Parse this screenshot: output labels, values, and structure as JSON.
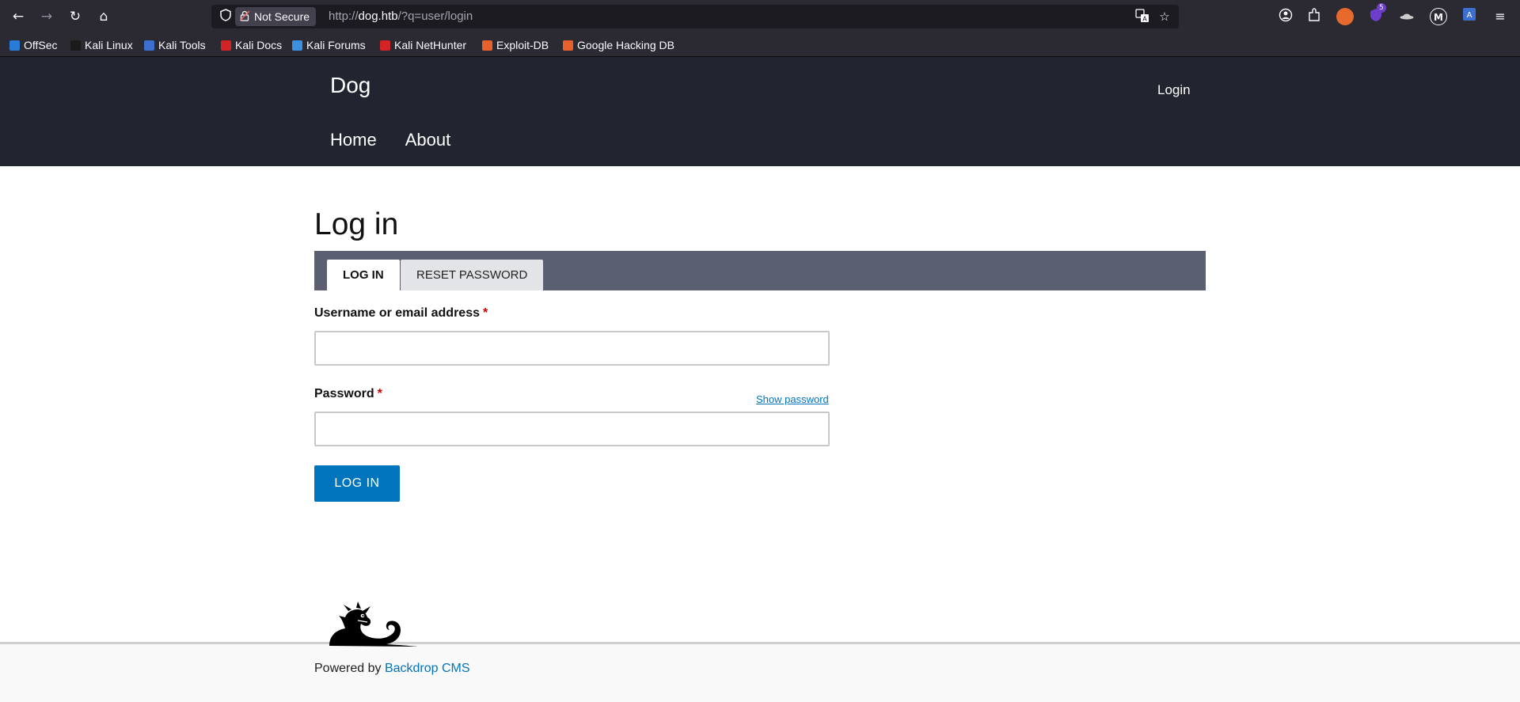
{
  "browser": {
    "nav": {
      "back_icon": "←",
      "forward_icon": "→",
      "reload_icon": "↻",
      "home_icon": "⌂"
    },
    "urlbar": {
      "security_label": "Not Secure",
      "url_prefix": "http://",
      "url_host": "dog.htb",
      "url_path": "/?q=user/login"
    },
    "extensions": {
      "badge_count": "5"
    },
    "bookmarks": [
      {
        "label": "OffSec",
        "color": "#2a7bd6"
      },
      {
        "label": "Kali Linux",
        "color": "#1b1b1b"
      },
      {
        "label": "Kali Tools",
        "color": "#3d6fd1"
      },
      {
        "label": "Kali Docs",
        "color": "#d22424"
      },
      {
        "label": "Kali Forums",
        "color": "#3d8fe0"
      },
      {
        "label": "Kali NetHunter",
        "color": "#d22424"
      },
      {
        "label": "Exploit-DB",
        "color": "#e8612c"
      },
      {
        "label": "Google Hacking DB",
        "color": "#e8612c"
      }
    ]
  },
  "site": {
    "name": "Dog",
    "header_login": "Login",
    "menu": [
      "Home",
      "About"
    ]
  },
  "page": {
    "title": "Log in",
    "tabs": [
      {
        "label": "LOG IN",
        "active": true
      },
      {
        "label": "RESET PASSWORD",
        "active": false
      }
    ],
    "form": {
      "username_label": "Username or email address",
      "password_label": "Password",
      "required_marker": "*",
      "username_value": "",
      "password_value": "",
      "show_password": "Show password",
      "submit_label": "LOG IN"
    }
  },
  "footer": {
    "powered_text": "Powered by",
    "powered_link": "Backdrop CMS"
  },
  "colors": {
    "header_bg": "#212530",
    "tabs_bg": "#5a6072",
    "link": "#0074bd",
    "button": "#0074bd",
    "required": "#cc0000"
  }
}
